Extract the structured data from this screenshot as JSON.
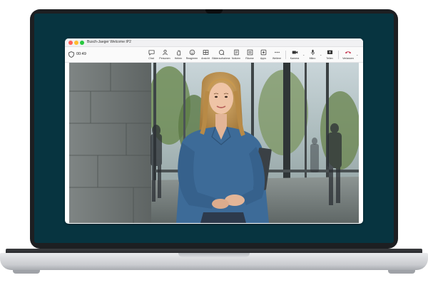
{
  "window": {
    "title": "Busch-Jaeger Welcome IP2",
    "timer": "00:49"
  },
  "toolbar": {
    "items": [
      {
        "label": "Chat",
        "icon": "chat-icon"
      },
      {
        "label": "Personen",
        "icon": "people-icon"
      },
      {
        "label": "Heben",
        "icon": "raise-hand-icon"
      },
      {
        "label": "Reagieren",
        "icon": "emoji-icon"
      },
      {
        "label": "Ansicht",
        "icon": "view-icon"
      },
      {
        "label": "Bilderaufnahme",
        "icon": "capture-icon"
      },
      {
        "label": "Notizen",
        "icon": "notes-icon"
      },
      {
        "label": "Räume",
        "icon": "rooms-icon"
      },
      {
        "label": "Apps",
        "icon": "apps-icon"
      },
      {
        "label": "Weitere",
        "icon": "more-icon"
      },
      {
        "label": "Kamera",
        "icon": "camera-icon"
      },
      {
        "label": "Mikro",
        "icon": "mic-icon"
      },
      {
        "label": "Teilen",
        "icon": "share-icon"
      },
      {
        "label": "Verlassen",
        "icon": "leave-icon"
      }
    ]
  },
  "colors": {
    "screen_bg": "#073440",
    "leave": "#c4314b"
  }
}
